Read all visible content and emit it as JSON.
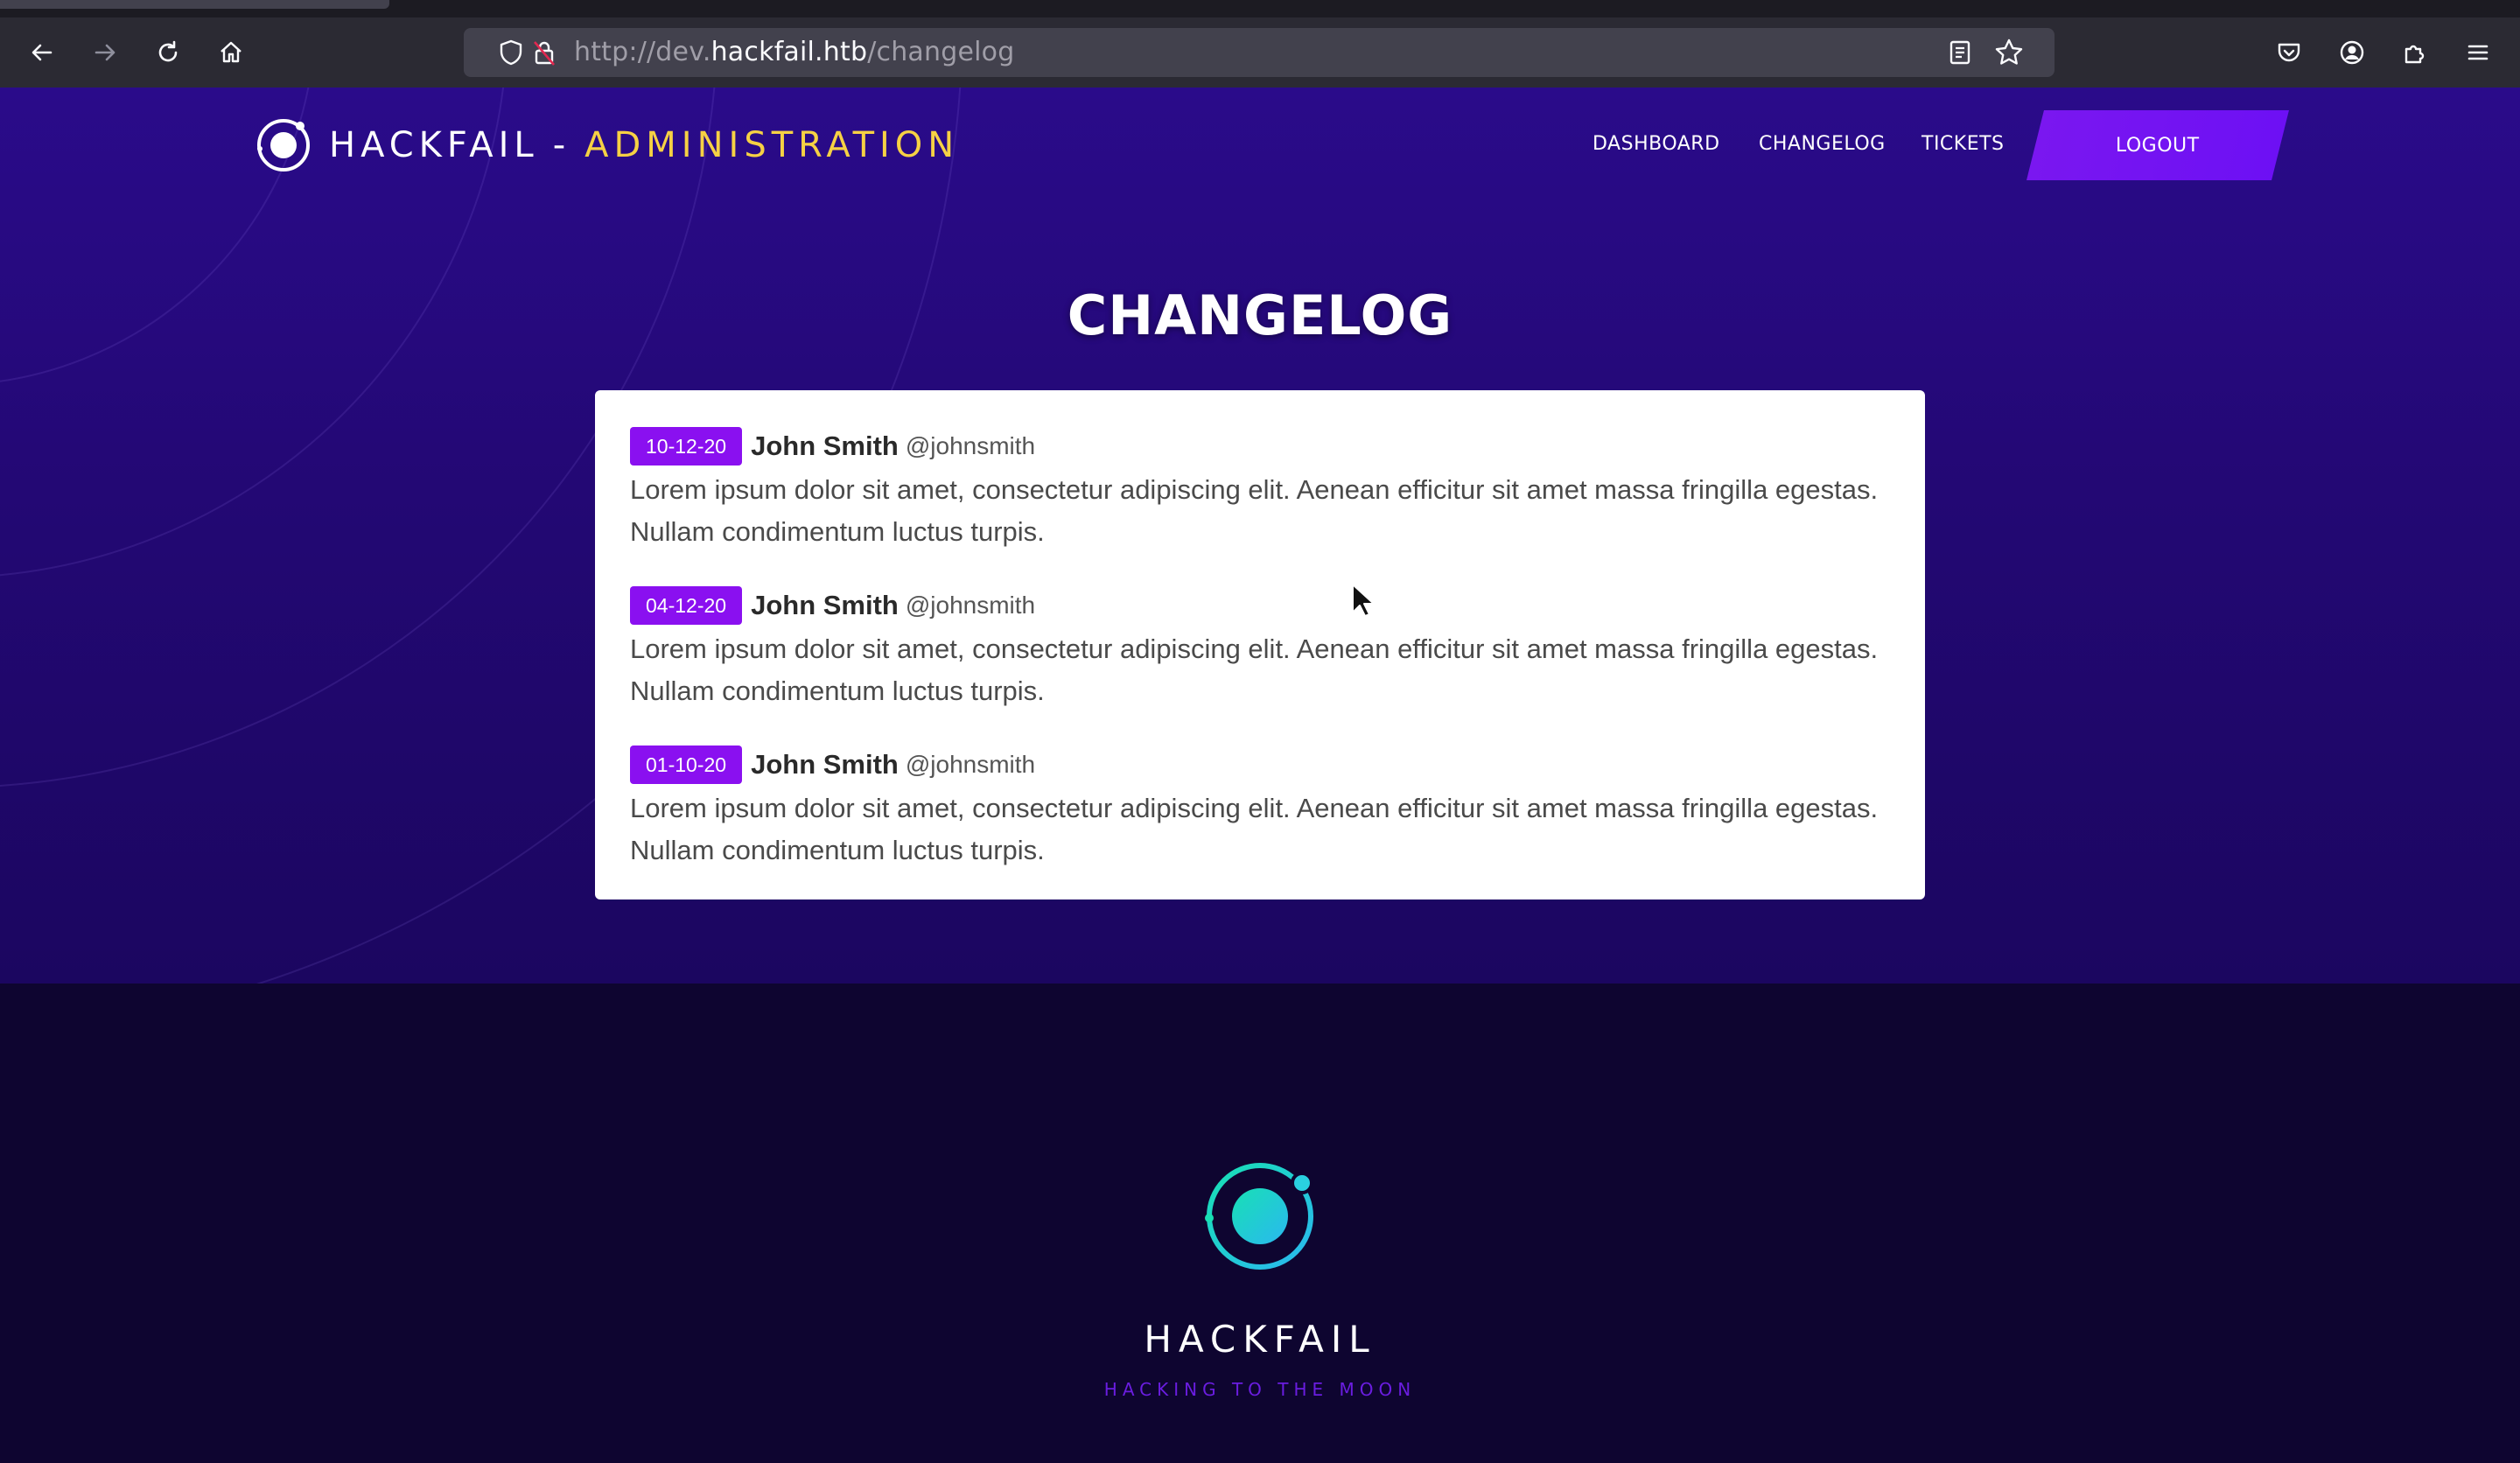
{
  "browser": {
    "url_prefix": "http://dev.",
    "url_host": "hackfail.htb",
    "url_path": "/changelog",
    "icons": [
      "back-icon",
      "forward-icon",
      "reload-icon",
      "home-icon",
      "shield-icon",
      "lock-icon",
      "reader-view-icon",
      "star-icon",
      "pocket-icon",
      "account-icon",
      "extensions-icon",
      "menu-icon"
    ]
  },
  "site": {
    "brand_name": "HACKFAIL",
    "brand_separator": "-",
    "brand_admin": "ADMINISTRATION",
    "nav": {
      "dashboard": "DASHBOARD",
      "changelog": "CHANGELOG",
      "tickets": "TICKETS",
      "logout": "LOGOUT"
    },
    "colors": {
      "accent": "#8a10f0",
      "admin_highlight": "#f6d144",
      "footer_logo": "#1fd3c6"
    }
  },
  "main": {
    "title": "CHANGELOG",
    "entries": [
      {
        "date": "10-12-20",
        "author": "John Smith",
        "handle": "@johnsmith",
        "text": "Lorem ipsum dolor sit amet, consectetur adipiscing elit. Aenean efficitur sit amet massa fringilla egestas. Nullam condimentum luctus turpis."
      },
      {
        "date": "04-12-20",
        "author": "John Smith",
        "handle": "@johnsmith",
        "text": "Lorem ipsum dolor sit amet, consectetur adipiscing elit. Aenean efficitur sit amet massa fringilla egestas. Nullam condimentum luctus turpis."
      },
      {
        "date": "01-10-20",
        "author": "John Smith",
        "handle": "@johnsmith",
        "text": "Lorem ipsum dolor sit amet, consectetur adipiscing elit. Aenean efficitur sit amet massa fringilla egestas. Nullam condimentum luctus turpis."
      }
    ]
  },
  "footer": {
    "name": "HACKFAIL",
    "tagline": "HACKING TO THE MOON"
  }
}
